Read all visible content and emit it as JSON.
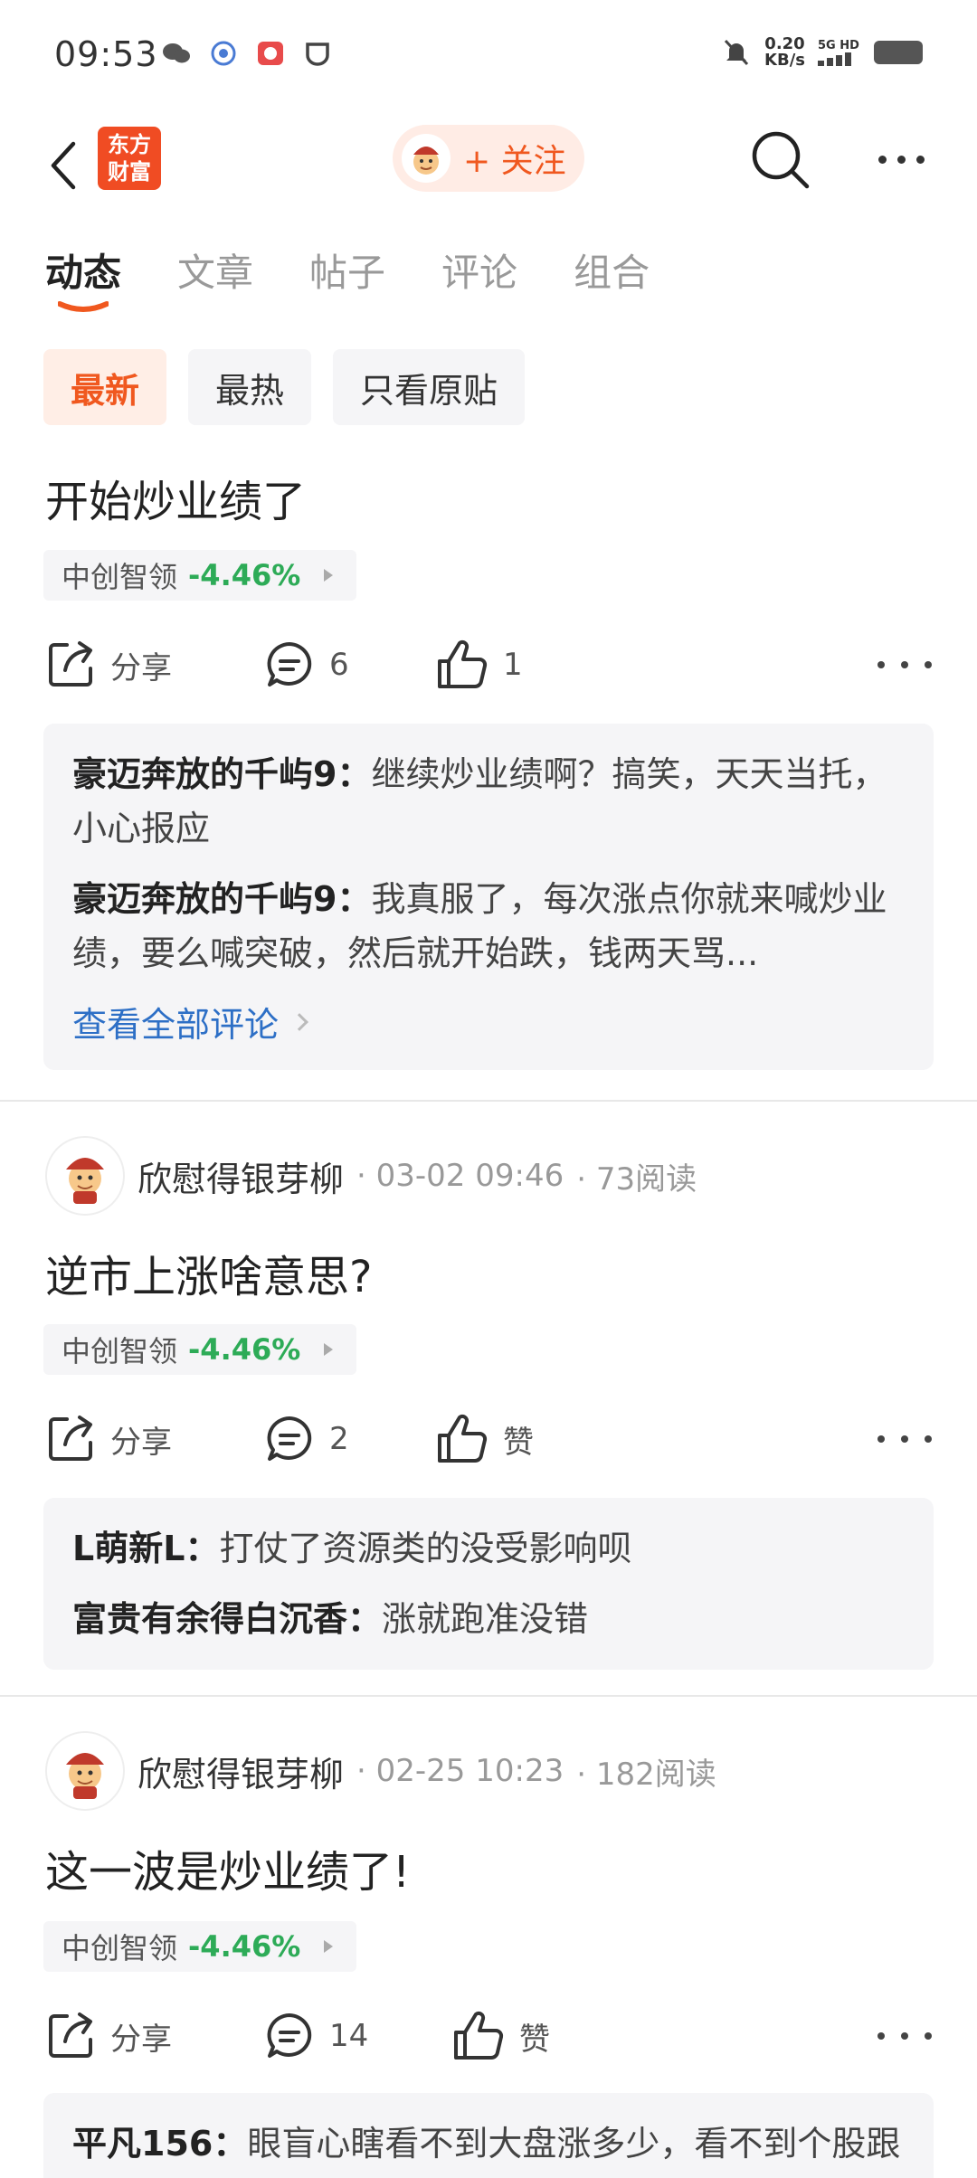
{
  "status": {
    "time": "09:53",
    "speed_value": "0.20",
    "speed_unit": "KB/s",
    "network": "5G HD"
  },
  "nav": {
    "brand": "东方财富",
    "follow_label": "+ 关注"
  },
  "tabs": [
    {
      "label": "动态",
      "active": true
    },
    {
      "label": "文章"
    },
    {
      "label": "帖子"
    },
    {
      "label": "评论"
    },
    {
      "label": "组合"
    }
  ],
  "filters": [
    {
      "label": "最新",
      "active": true
    },
    {
      "label": "最热"
    },
    {
      "label": "只看原贴"
    }
  ],
  "colors": {
    "accent": "#f0581f",
    "stock_down": "#2dab57",
    "link": "#2d6fc6"
  },
  "posts": [
    {
      "title": "开始炒业绩了",
      "stock": {
        "name": "中创智领",
        "change": "-4.46%"
      },
      "actions": {
        "share": "分享",
        "comments": "6",
        "likes": "1"
      },
      "comments": [
        {
          "user": "豪迈奔放的千屿9：",
          "text": "继续炒业绩啊？搞笑，天天当托，小心报应"
        },
        {
          "user": "豪迈奔放的千屿9：",
          "text": "我真服了，每次涨点你就来喊炒业绩，要么喊突破，然后就开始跌，钱两天骂..."
        }
      ],
      "view_all": "查看全部评论"
    },
    {
      "author": "欣慰得银芽柳",
      "time": "· 03-02 09:46",
      "reads": "· 73阅读",
      "title": "逆市上涨啥意思?",
      "stock": {
        "name": "中创智领",
        "change": "-4.46%"
      },
      "actions": {
        "share": "分享",
        "comments": "2",
        "likes": "赞"
      },
      "comments": [
        {
          "user": "L萌新L：",
          "text": "打仗了资源类的没受影响呗"
        },
        {
          "user": "富贵有余得白沉香：",
          "text": "涨就跑准没错"
        }
      ]
    },
    {
      "author": "欣慰得银芽柳",
      "time": "· 02-25 10:23",
      "reads": "· 182阅读",
      "title": "这一波是炒业绩了!",
      "stock": {
        "name": "中创智领",
        "change": "-4.46%"
      },
      "actions": {
        "share": "分享",
        "comments": "14",
        "likes": "赞"
      },
      "comments": [
        {
          "user": "平凡156：",
          "text": "眼盲心瞎看不到大盘涨多少，看不到个股跟什么板块在涨，这就是平凡的数据了，就不..."
        }
      ]
    }
  ]
}
